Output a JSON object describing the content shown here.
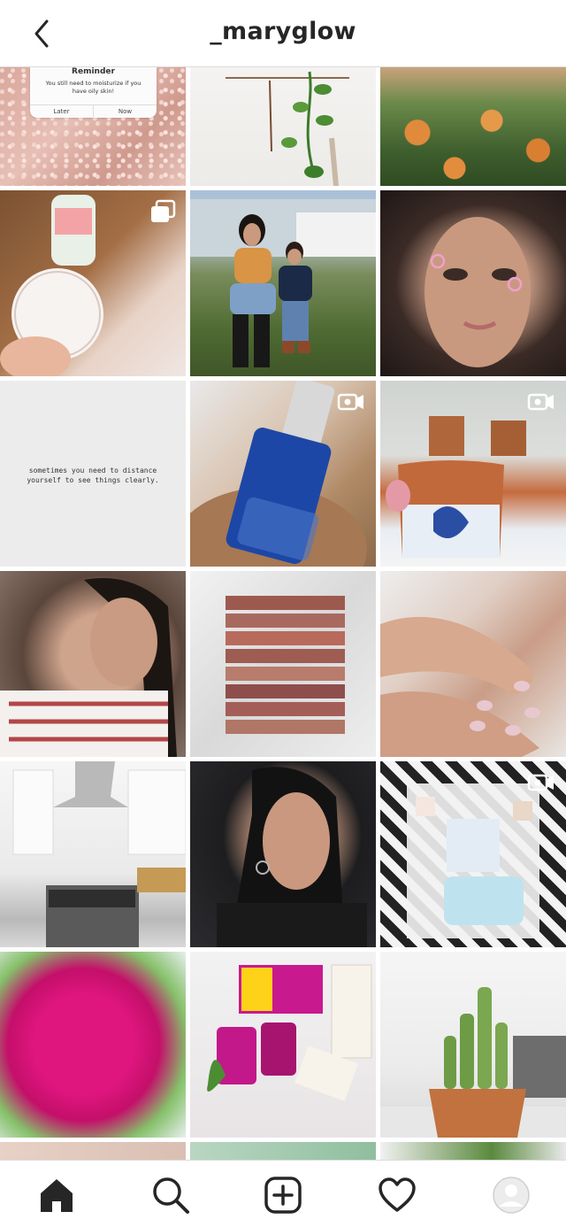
{
  "header": {
    "title": "_maryglow"
  },
  "posts": [
    {
      "reminder_title": "Reminder",
      "reminder_body": "You still need to moisturize if you have oily skin!",
      "later": "Later",
      "now": "Now"
    },
    {},
    {},
    {
      "badge": "carousel-icon"
    },
    {},
    {},
    {
      "quote": "sometimes you need to distance\nyourself to see things clearly."
    },
    {
      "badge": "video-icon"
    },
    {
      "badge": "video-icon"
    },
    {},
    {},
    {},
    {},
    {},
    {
      "badge": "video-icon"
    },
    {},
    {},
    {}
  ],
  "bottom_nav": {
    "items": [
      "home-icon",
      "search-icon",
      "new-post-icon",
      "activity-heart-icon",
      "profile-avatar"
    ]
  }
}
